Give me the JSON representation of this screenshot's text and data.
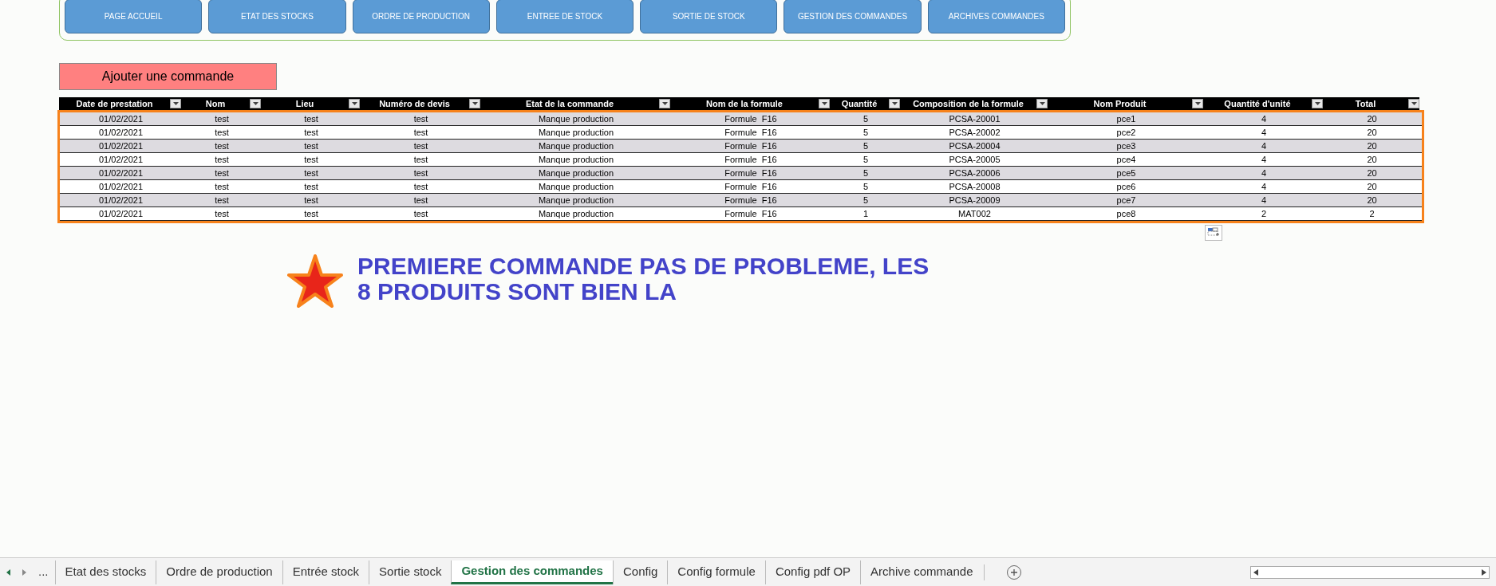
{
  "nav_buttons": [
    "PAGE ACCUEIL",
    "ETAT DES STOCKS",
    "ORDRE DE PRODUCTION",
    "ENTREE DE STOCK",
    "SORTIE DE STOCK",
    "GESTION DES COMMANDES",
    "ARCHIVES COMMANDES"
  ],
  "add_button": "Ajouter une commande",
  "table": {
    "columns": [
      "Date de prestation",
      "Nom",
      "Lieu",
      "Numéro de devis",
      "Etat de la commande",
      "Nom de la formule",
      "Quantité",
      "Composition de la formule",
      "Nom Produit",
      "Quantité d'unité",
      "Total"
    ],
    "rows": [
      [
        "01/02/2021",
        "test",
        "test",
        "test",
        "Manque production",
        "Formule  F16",
        "5",
        "PCSA-20001",
        "pce1",
        "4",
        "20"
      ],
      [
        "01/02/2021",
        "test",
        "test",
        "test",
        "Manque production",
        "Formule  F16",
        "5",
        "PCSA-20002",
        "pce2",
        "4",
        "20"
      ],
      [
        "01/02/2021",
        "test",
        "test",
        "test",
        "Manque production",
        "Formule  F16",
        "5",
        "PCSA-20004",
        "pce3",
        "4",
        "20"
      ],
      [
        "01/02/2021",
        "test",
        "test",
        "test",
        "Manque production",
        "Formule  F16",
        "5",
        "PCSA-20005",
        "pce4",
        "4",
        "20"
      ],
      [
        "01/02/2021",
        "test",
        "test",
        "test",
        "Manque production",
        "Formule  F16",
        "5",
        "PCSA-20006",
        "pce5",
        "4",
        "20"
      ],
      [
        "01/02/2021",
        "test",
        "test",
        "test",
        "Manque production",
        "Formule  F16",
        "5",
        "PCSA-20008",
        "pce6",
        "4",
        "20"
      ],
      [
        "01/02/2021",
        "test",
        "test",
        "test",
        "Manque production",
        "Formule  F16",
        "5",
        "PCSA-20009",
        "pce7",
        "4",
        "20"
      ],
      [
        "01/02/2021",
        "test",
        "test",
        "test",
        "Manque production",
        "Formule  F16",
        "1",
        "MAT002",
        "pce8",
        "2",
        "2"
      ]
    ]
  },
  "annotation": {
    "lines": [
      "PREMIERE COMMANDE PAS DE PROBLEME, LES",
      "8 PRODUITS SONT BIEN LA"
    ]
  },
  "sheet_tabs": {
    "more": "...",
    "tabs": [
      {
        "label": "Etat des stocks",
        "selected": false
      },
      {
        "label": "Ordre de production",
        "selected": false
      },
      {
        "label": "Entrée stock",
        "selected": false
      },
      {
        "label": "Sortie stock",
        "selected": false
      },
      {
        "label": "Gestion des commandes",
        "selected": true
      },
      {
        "label": "Config",
        "selected": false
      },
      {
        "label": "Config formule",
        "selected": false
      },
      {
        "label": "Config pdf OP",
        "selected": false
      },
      {
        "label": "Archive commande",
        "selected": false
      }
    ]
  }
}
